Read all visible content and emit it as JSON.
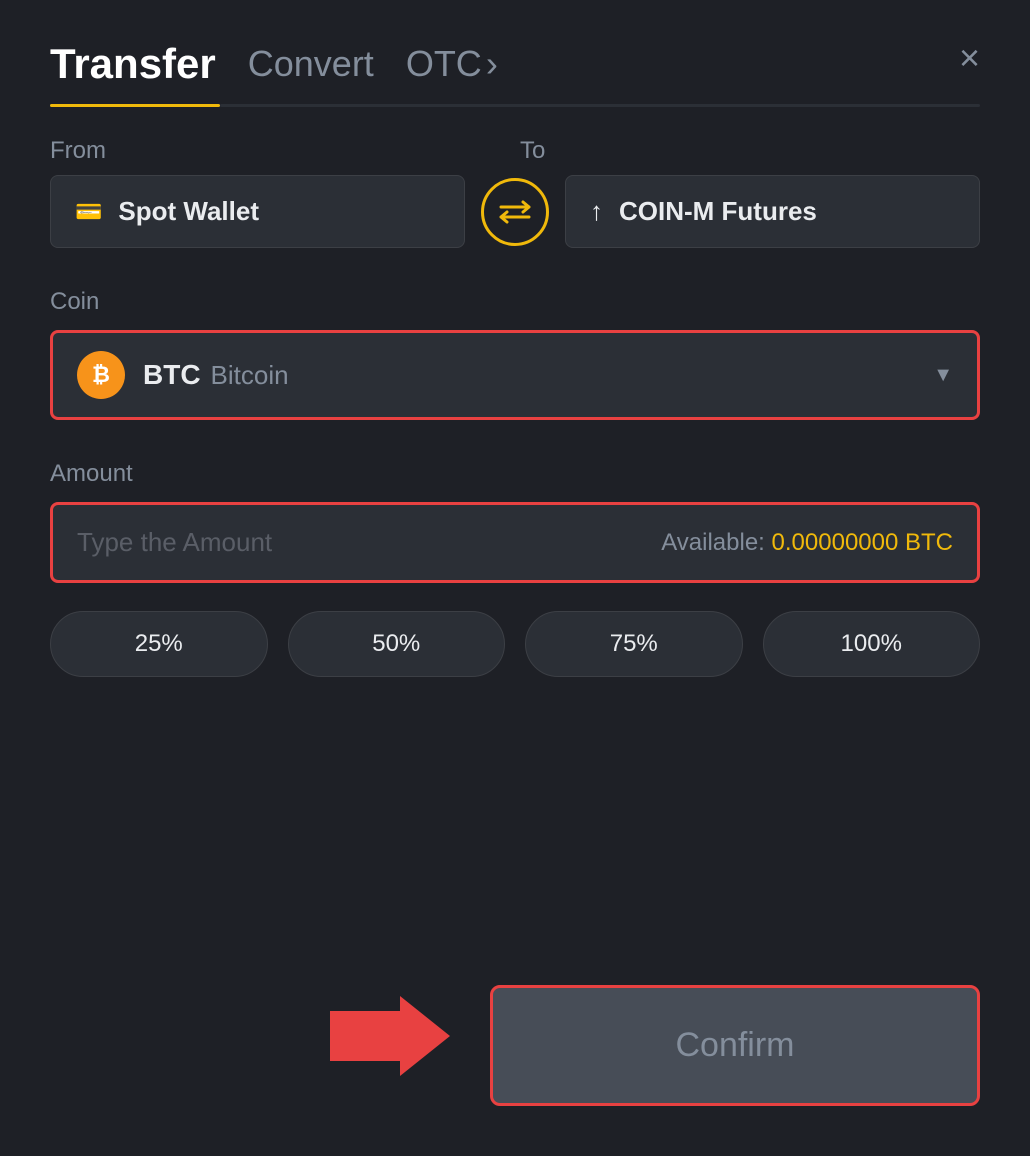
{
  "header": {
    "active_tab": "Transfer",
    "tabs": [
      "Transfer",
      "Convert",
      "OTC"
    ],
    "close_label": "×"
  },
  "from_label": "From",
  "to_label": "To",
  "from_wallet": {
    "label": "Spot Wallet",
    "icon": "💳"
  },
  "to_wallet": {
    "label": "COIN-M Futures",
    "icon": "↑"
  },
  "coin_section": {
    "label": "Coin",
    "symbol": "BTC",
    "name": "Bitcoin"
  },
  "amount_section": {
    "label": "Amount",
    "placeholder": "Type the Amount",
    "available_label": "Available:",
    "available_value": "0.00000000 BTC"
  },
  "percent_buttons": [
    "25%",
    "50%",
    "75%",
    "100%"
  ],
  "confirm_button": "Confirm"
}
